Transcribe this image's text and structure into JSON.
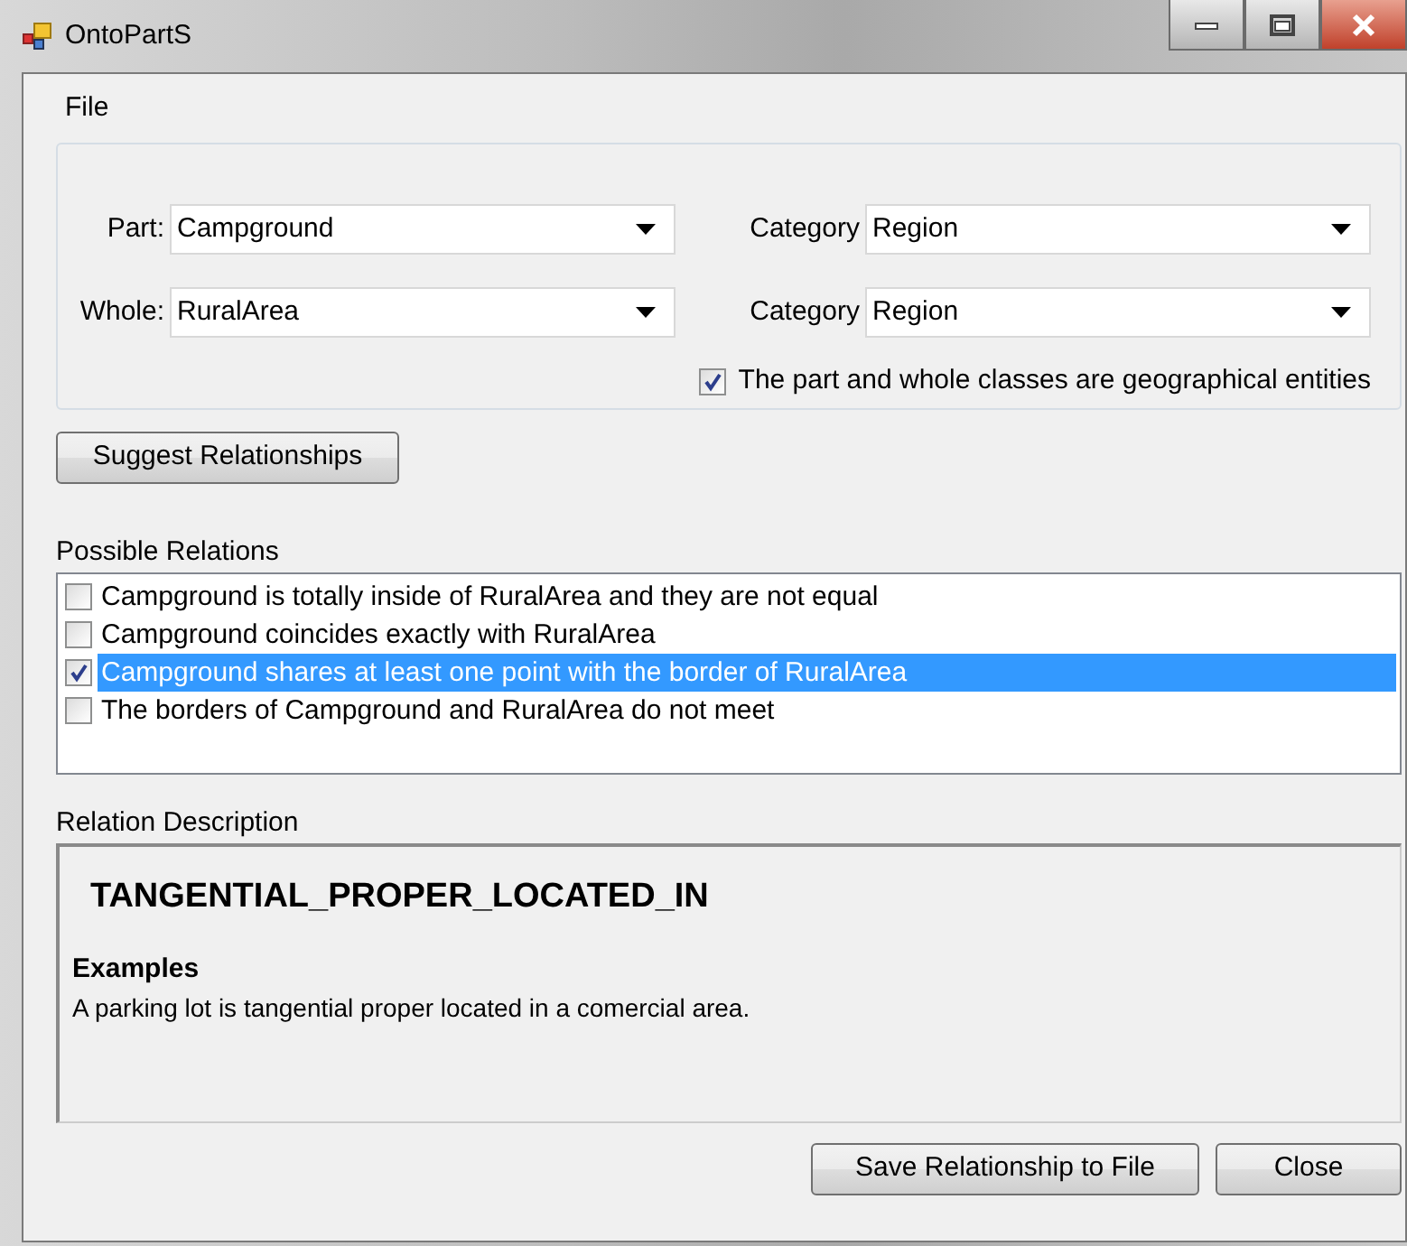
{
  "window": {
    "title": "OntoPartS"
  },
  "menu": [
    {
      "label": "File"
    }
  ],
  "fields": [
    {
      "label": "Part:",
      "value": "Campground",
      "category_label": "Category",
      "category_value": "Region"
    },
    {
      "label": "Whole:",
      "value": "RuralArea",
      "category_label": "Category",
      "category_value": "Region"
    }
  ],
  "geo_checkbox": {
    "label": "The part and whole classes are geographical entities",
    "checked": true
  },
  "suggest_button": "Suggest Relationships",
  "relations": {
    "label": "Possible Relations",
    "items": [
      {
        "text": "Campground is totally inside of RuralArea and they are not equal",
        "checked": false,
        "selected": false
      },
      {
        "text": "Campground coincides exactly with RuralArea",
        "checked": false,
        "selected": false
      },
      {
        "text": "Campground shares at least one point with the border of RuralArea",
        "checked": true,
        "selected": true
      },
      {
        "text": "The borders of Campground and RuralArea do not meet",
        "checked": false,
        "selected": false
      }
    ]
  },
  "description": {
    "label": "Relation Description",
    "name": "TANGENTIAL_PROPER_LOCATED_IN",
    "heading": "Examples",
    "text": "A parking lot is tangential proper located in a comercial area."
  },
  "buttons": [
    "Save Relationship to File",
    "Close"
  ]
}
